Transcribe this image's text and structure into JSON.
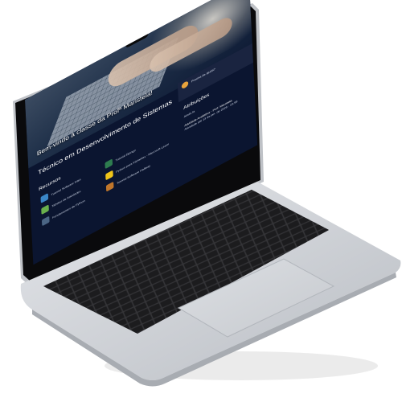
{
  "hero": {
    "welcome": "Bem-vindo à classe da Profª Maristela!"
  },
  "course": {
    "title": "Técnico em Desenvolvimento de Sistemas"
  },
  "help": {
    "label": "Precisa de ajuda?"
  },
  "resources": {
    "title": "Recursos",
    "items": [
      {
        "label": "Tutorial Software Files",
        "icon": "file-icon",
        "color": "#3a86c8"
      },
      {
        "label": "Tutorial Django",
        "icon": "django-icon",
        "color": "#2e7d4f"
      },
      {
        "label": "Tabelas de Atividades",
        "icon": "table-icon",
        "color": "#6ab04c"
      },
      {
        "label": "Python para Iniciantes - Microsoft Learn",
        "icon": "python-icon",
        "color": "#f0c419"
      },
      {
        "label": "Fundamentos de Python",
        "icon": "book-icon",
        "color": "#4b6584"
      },
      {
        "label": "Tutorial Software Hallway",
        "icon": "hallway-icon",
        "color": "#c0762b"
      }
    ]
  },
  "attributions": {
    "title": "Atribuições",
    "items": [
      {
        "text": "Ainda lá"
      },
      {
        "text": "Atividade Avaliativa - Prof. Maristela"
      },
      {
        "text": "Atividade até 13 de jan. de 2026 · 23:59"
      }
    ]
  },
  "colors": {
    "screen_bg": "#0b1530",
    "accent": "#e8a33c"
  }
}
